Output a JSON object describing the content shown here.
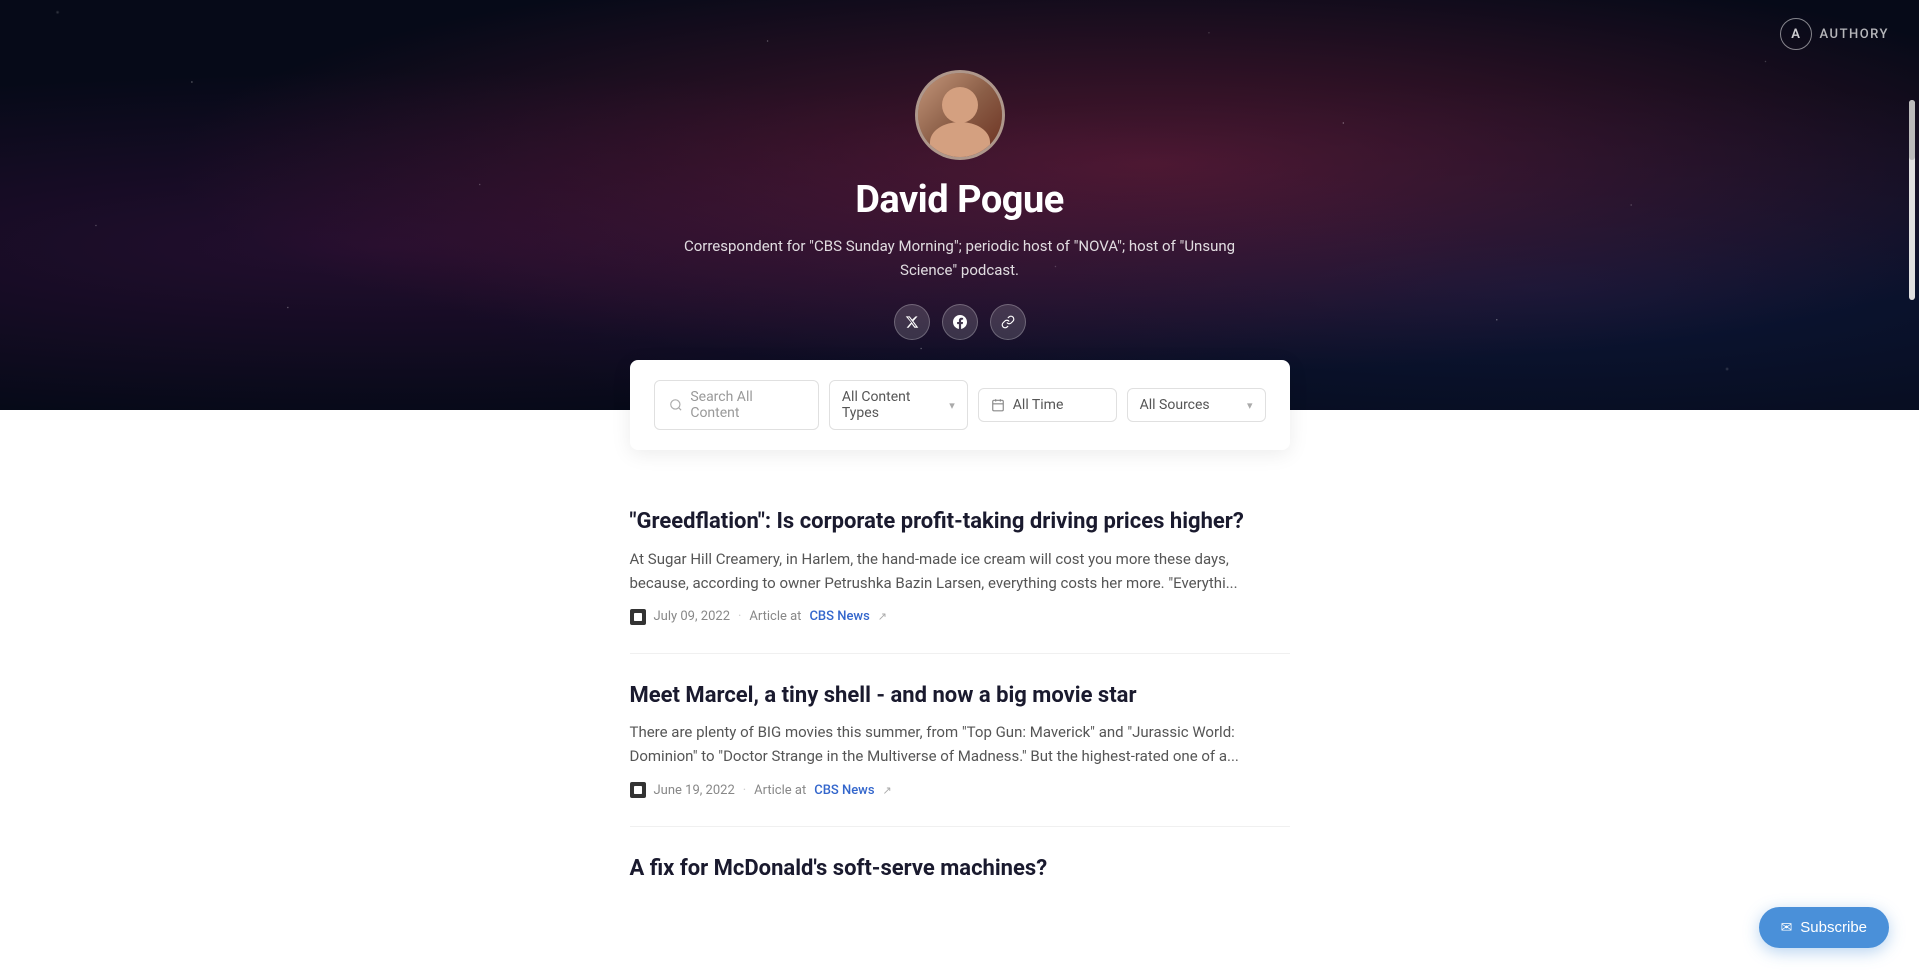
{
  "brand": {
    "logo_letter": "A",
    "logo_text": "AUTHORY"
  },
  "hero": {
    "name": "David Pogue",
    "bio": "Correspondent for \"CBS Sunday Morning\"; periodic host of \"NOVA\"; host of \"Unsung Science\" podcast.",
    "social": [
      {
        "id": "twitter",
        "icon": "𝕏",
        "label": "Twitter"
      },
      {
        "id": "facebook",
        "icon": "f",
        "label": "Facebook"
      },
      {
        "id": "link",
        "icon": "🔗",
        "label": "Website"
      }
    ]
  },
  "filters": {
    "search_placeholder": "Search All Content",
    "content_types_label": "All Content Types",
    "time_label": "All Time",
    "sources_label": "All Sources"
  },
  "articles": [
    {
      "id": "article-1",
      "title": "\"Greedflation\": Is corporate profit-taking driving prices higher?",
      "excerpt": "At Sugar Hill Creamery, in Harlem, the hand-made ice cream will cost you more these days, because, according to owner Petrushka Bazin Larsen, everything costs her more. \"Everythi...",
      "date": "July 09, 2022",
      "type": "Article",
      "source": "CBS News",
      "has_external_link": true
    },
    {
      "id": "article-2",
      "title": "Meet Marcel, a tiny shell - and now a big movie star",
      "excerpt": "There are plenty of BIG movies this summer, from \"Top Gun: Maverick\" and \"Jurassic World: Dominion\" to \"Doctor Strange in the Multiverse of Madness.\" But the highest-rated one of a...",
      "date": "June 19, 2022",
      "type": "Article",
      "source": "CBS News",
      "has_external_link": true
    },
    {
      "id": "article-3",
      "title": "A fix for McDonald's soft-serve machines?",
      "excerpt": "",
      "date": "",
      "type": "",
      "source": "",
      "has_external_link": false
    }
  ],
  "subscribe_button": {
    "label": "Subscribe",
    "icon": "✉"
  }
}
